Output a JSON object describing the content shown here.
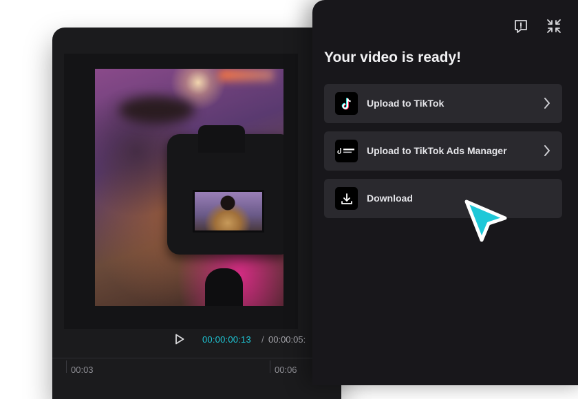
{
  "player": {
    "current_time": "00:00:00:13",
    "separator": "/",
    "total_time": "00:00:05:"
  },
  "timeline": {
    "ticks": [
      "00:03",
      "00:06"
    ]
  },
  "panel": {
    "title": "Your video is ready!",
    "header_icons": [
      "feedback-icon",
      "collapse-icon"
    ],
    "options": [
      {
        "label": "Upload to TikTok",
        "icon": "tiktok-icon",
        "has_chevron": true
      },
      {
        "label": "Upload to TikTok Ads Manager",
        "icon": "tiktok-business-icon",
        "has_chevron": true
      },
      {
        "label": "Download",
        "icon": "download-icon",
        "has_chevron": false
      }
    ]
  },
  "colors": {
    "accent": "#1ec8d8",
    "panel_bg": "#18171b",
    "option_bg": "#2a292e"
  }
}
